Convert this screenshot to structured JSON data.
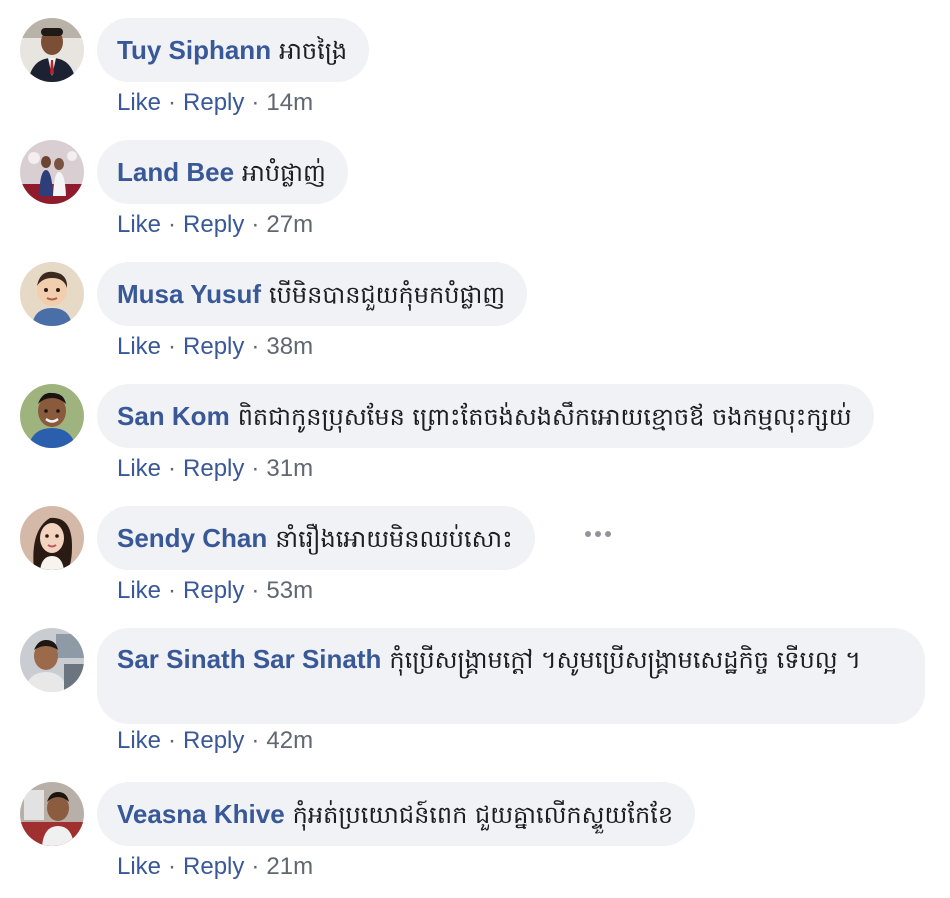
{
  "labels": {
    "like": "Like",
    "reply": "Reply",
    "separator": "·"
  },
  "comments": [
    {
      "author": "Tuy Siphann",
      "text": "អាចង្រៃ",
      "time": "14m"
    },
    {
      "author": "Land Bee",
      "text": "អាបំផ្លាញ់",
      "time": "27m"
    },
    {
      "author": "Musa Yusuf",
      "text": "បើមិនបានជួយកុំមកបំផ្លាញ",
      "time": "38m"
    },
    {
      "author": "San Kom",
      "text": "ពិតជាកូនប្រុសមែន ព្រោះតែចង់សងសឹកអោយខ្មោចឪ ចងកម្មលុះក្សយ់",
      "time": "31m"
    },
    {
      "author": "Sendy Chan",
      "text": "នាំរឿងអោយមិនឈប់សោះ",
      "time": "53m"
    },
    {
      "author": "Sar Sinath Sar Sinath",
      "text": "កុំប្រើសង្គ្រាមក្តៅ ។សូមប្រើសង្គ្រាមសេដ្ឋកិច្ច ទើបល្អ ។",
      "time": "42m"
    },
    {
      "author": "Veasna Khive",
      "text": "កុំអត់ប្រយោជន៍ពេក ជួយគ្នាលើកស្ទួយកែខែ",
      "time": "21m"
    }
  ],
  "colors": {
    "author": "#385898",
    "link": "#385898",
    "meta": "#606770",
    "bubble": "#f0f2f5",
    "text": "#1c1e21"
  },
  "icons": {
    "more_options": "more-options-icon"
  }
}
